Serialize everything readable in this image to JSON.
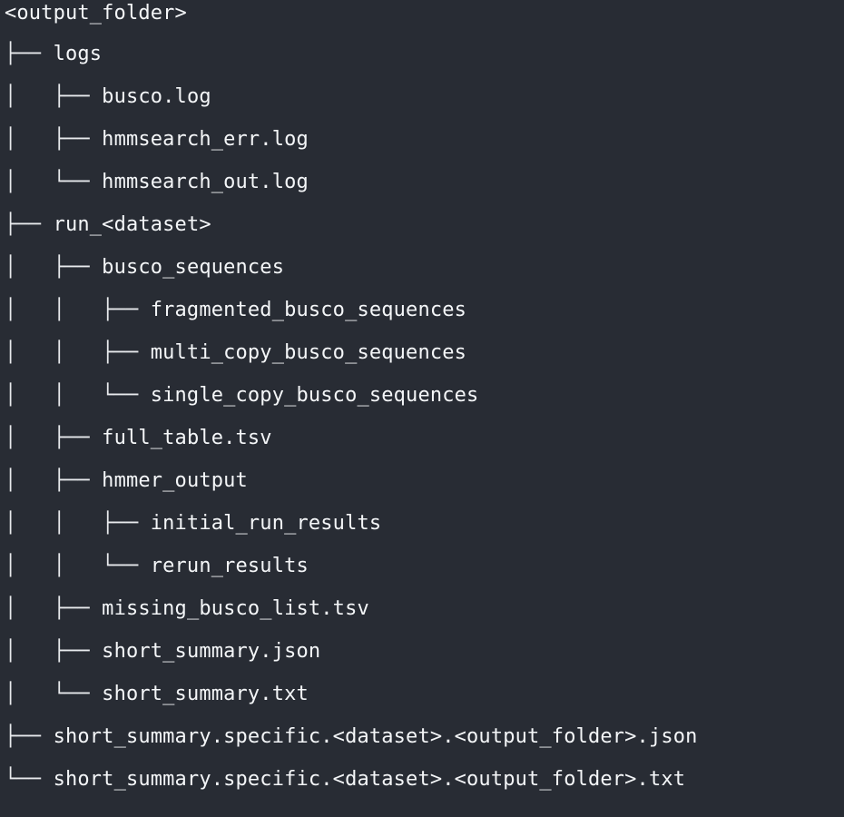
{
  "tree": {
    "lines": [
      {
        "prefix": "",
        "name": "<output_folder>"
      },
      {
        "prefix": "├── ",
        "name": "logs"
      },
      {
        "prefix": "│   ├── ",
        "name": "busco.log"
      },
      {
        "prefix": "│   ├── ",
        "name": "hmmsearch_err.log"
      },
      {
        "prefix": "│   └── ",
        "name": "hmmsearch_out.log"
      },
      {
        "prefix": "├── ",
        "name": "run_<dataset>"
      },
      {
        "prefix": "│   ├── ",
        "name": "busco_sequences"
      },
      {
        "prefix": "│   │   ├── ",
        "name": "fragmented_busco_sequences"
      },
      {
        "prefix": "│   │   ├── ",
        "name": "multi_copy_busco_sequences"
      },
      {
        "prefix": "│   │   └── ",
        "name": "single_copy_busco_sequences"
      },
      {
        "prefix": "│   ├── ",
        "name": "full_table.tsv"
      },
      {
        "prefix": "│   ├── ",
        "name": "hmmer_output"
      },
      {
        "prefix": "│   │   ├── ",
        "name": "initial_run_results"
      },
      {
        "prefix": "│   │   └── ",
        "name": "rerun_results"
      },
      {
        "prefix": "│   ├── ",
        "name": "missing_busco_list.tsv"
      },
      {
        "prefix": "│   ├── ",
        "name": "short_summary.json"
      },
      {
        "prefix": "│   └── ",
        "name": "short_summary.txt"
      },
      {
        "prefix": "├── ",
        "name": "short_summary.specific.<dataset>.<output_folder>.json"
      },
      {
        "prefix": "└── ",
        "name": "short_summary.specific.<dataset>.<output_folder>.txt"
      }
    ]
  }
}
